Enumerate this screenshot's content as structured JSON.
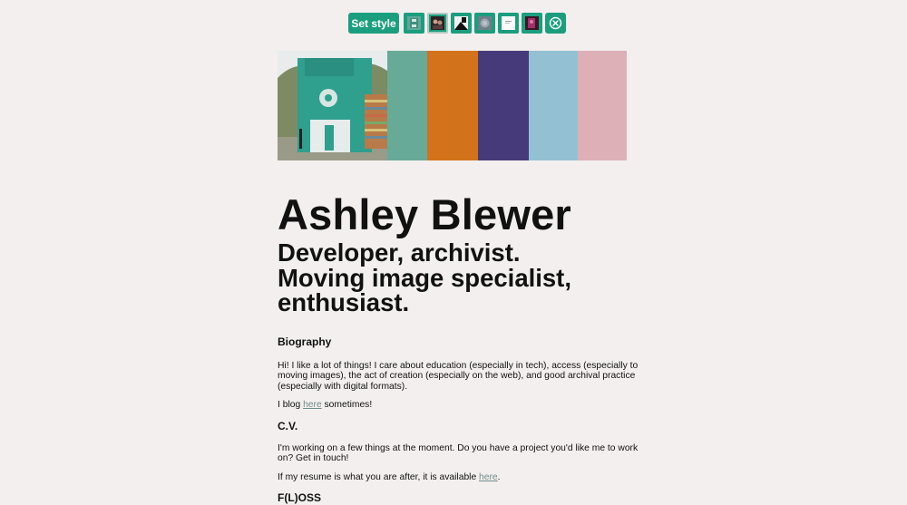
{
  "toolbar": {
    "set_style_label": "Set style",
    "thumbnails": [
      {
        "name": "floppy-style-thumb",
        "color": "#4d9d8f"
      },
      {
        "name": "photo-dark-style-thumb",
        "color": "#3b2a2c"
      },
      {
        "name": "bw-graphic-style-thumb",
        "color": "#222222"
      },
      {
        "name": "gray-blur-style-thumb",
        "color": "#7c8e96"
      },
      {
        "name": "white-page-style-thumb",
        "color": "#f7f7f7"
      },
      {
        "name": "magenta-photo-style-thumb",
        "color": "#8a2a55"
      }
    ],
    "close_icon": "close-circle-icon"
  },
  "hero": {
    "photo_alt": "floppy disk sculpture photo",
    "swatches": [
      "#68aa98",
      "#d2731c",
      "#473a7a",
      "#93c1d3",
      "#ddb0b8"
    ]
  },
  "header": {
    "name": "Ashley Blewer",
    "tagline_line1": "Developer, archivist.",
    "tagline_line2": "Moving image specialist, enthusiast."
  },
  "biography": {
    "heading": "Biography",
    "paragraph": "Hi! I like a lot of things! I care about education (especially in tech), access (especially to moving images), the act of creation (especially on the web), and good archival practice (especially with digital formats).",
    "blog_before": "I blog ",
    "blog_link": "here",
    "blog_after": " sometimes!"
  },
  "cv": {
    "heading": "C.V.",
    "paragraph": "I'm working on a few things at the moment. Do you have a project you'd like me to work on? Get in touch!",
    "resume_before": "If my resume is what you are after, it is available ",
    "resume_link": "here",
    "resume_after": "."
  },
  "floss": {
    "heading": "F(L)OSS"
  },
  "colors": {
    "accent": "#1b9e7e",
    "background": "#f3efee",
    "link": "#6f8d8a"
  }
}
